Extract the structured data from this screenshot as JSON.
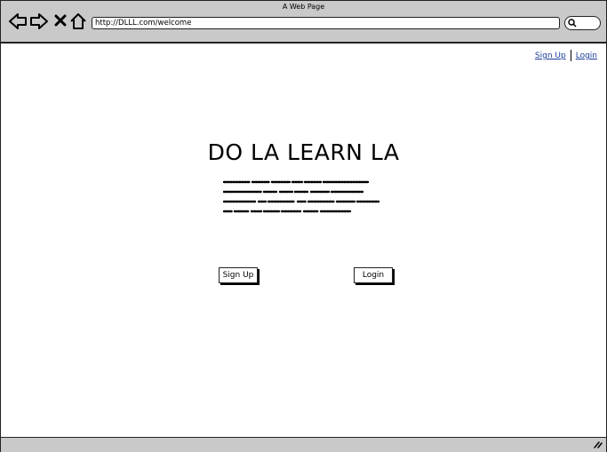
{
  "browser": {
    "title": "A Web Page",
    "url": "http://DLLL.com/welcome"
  },
  "header": {
    "signup_link": "Sign Up",
    "login_link": "Login"
  },
  "main": {
    "heading": "DO LA LEARN LA",
    "signup_button": "Sign Up",
    "login_button": "Login"
  },
  "icons": [
    "back-arrow-icon",
    "forward-arrow-icon",
    "close-icon",
    "home-icon",
    "search-icon",
    "resize-grip-icon"
  ]
}
